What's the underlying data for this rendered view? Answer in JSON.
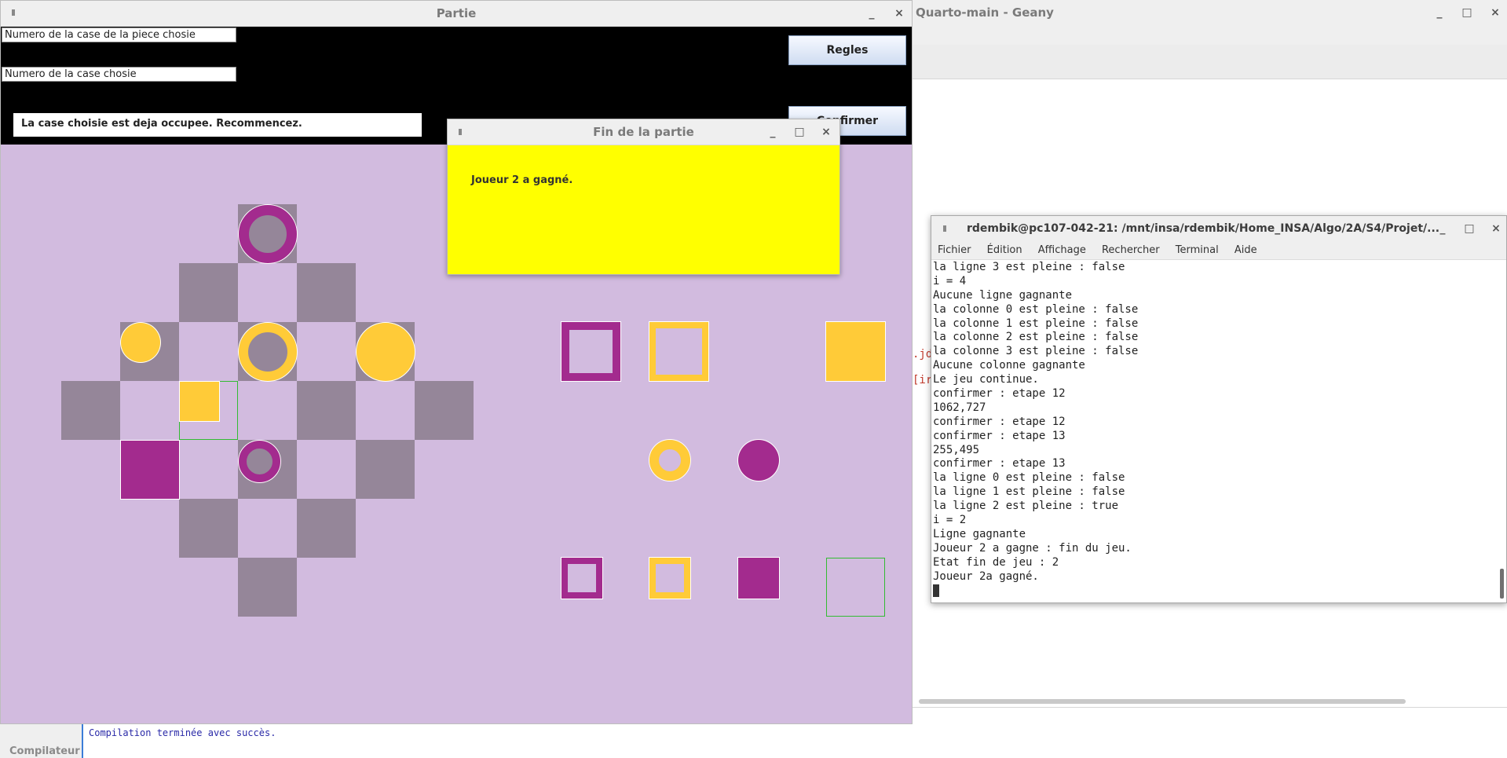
{
  "geany": {
    "title": "Quarto-main - Geany",
    "side_fragments": [
      ".jd",
      "[ir"
    ],
    "compiler_tab": "Compilateur",
    "compiler_message": "Compilation terminée avec succès.",
    "controls": [
      "_",
      "□",
      "×"
    ]
  },
  "partie": {
    "title": "Partie",
    "field1_value": "Numero de la case de la piece chosie",
    "field2_value": "Numero de la case chosie",
    "message": "La case choisie est deja occupee. Recommencez.",
    "regles_label": "Regles",
    "confirmer_label": "Confirmer",
    "controls": [
      "_",
      "×"
    ],
    "colors": {
      "board_bg": "#d2bbdf",
      "dark_cell": "#958699",
      "purple": "#a32b8e",
      "yellow": "#ffcb38",
      "highlight": "#33bb33"
    }
  },
  "dialog": {
    "title": "Fin de la partie",
    "message": "Joueur 2 a gagné.",
    "controls": [
      "_",
      "□",
      "×"
    ],
    "bg_color": "#ffff00"
  },
  "terminal": {
    "title": "rdembik@pc107-042-21: /mnt/insa/rdembik/Home_INSA/Algo/2A/S4/Projet/...",
    "menu": [
      "Fichier",
      "Édition",
      "Affichage",
      "Rechercher",
      "Terminal",
      "Aide"
    ],
    "controls": [
      "_",
      "□",
      "×"
    ],
    "lines": [
      "la ligne 3 est pleine : false",
      "i = 4",
      "Aucune ligne gagnante",
      "la colonne 0 est pleine : false",
      "la colonne 1 est pleine : false",
      "la colonne 2 est pleine : false",
      "la colonne 3 est pleine : false",
      "Aucune colonne gagnante",
      "Le jeu continue.",
      "confirmer : etape 12",
      "1062,727",
      "confirmer : etape 12",
      "confirmer : etape 13",
      "255,495",
      "confirmer : etape 13",
      "la ligne 0 est pleine : false",
      "la ligne 1 est pleine : false",
      "la ligne 2 est pleine : true",
      "i = 2",
      "Ligne gagnante",
      "Joueur 2 a gagne : fin du jeu.",
      "Etat fin de jeu : 2",
      "Joueur 2a gagné."
    ]
  }
}
